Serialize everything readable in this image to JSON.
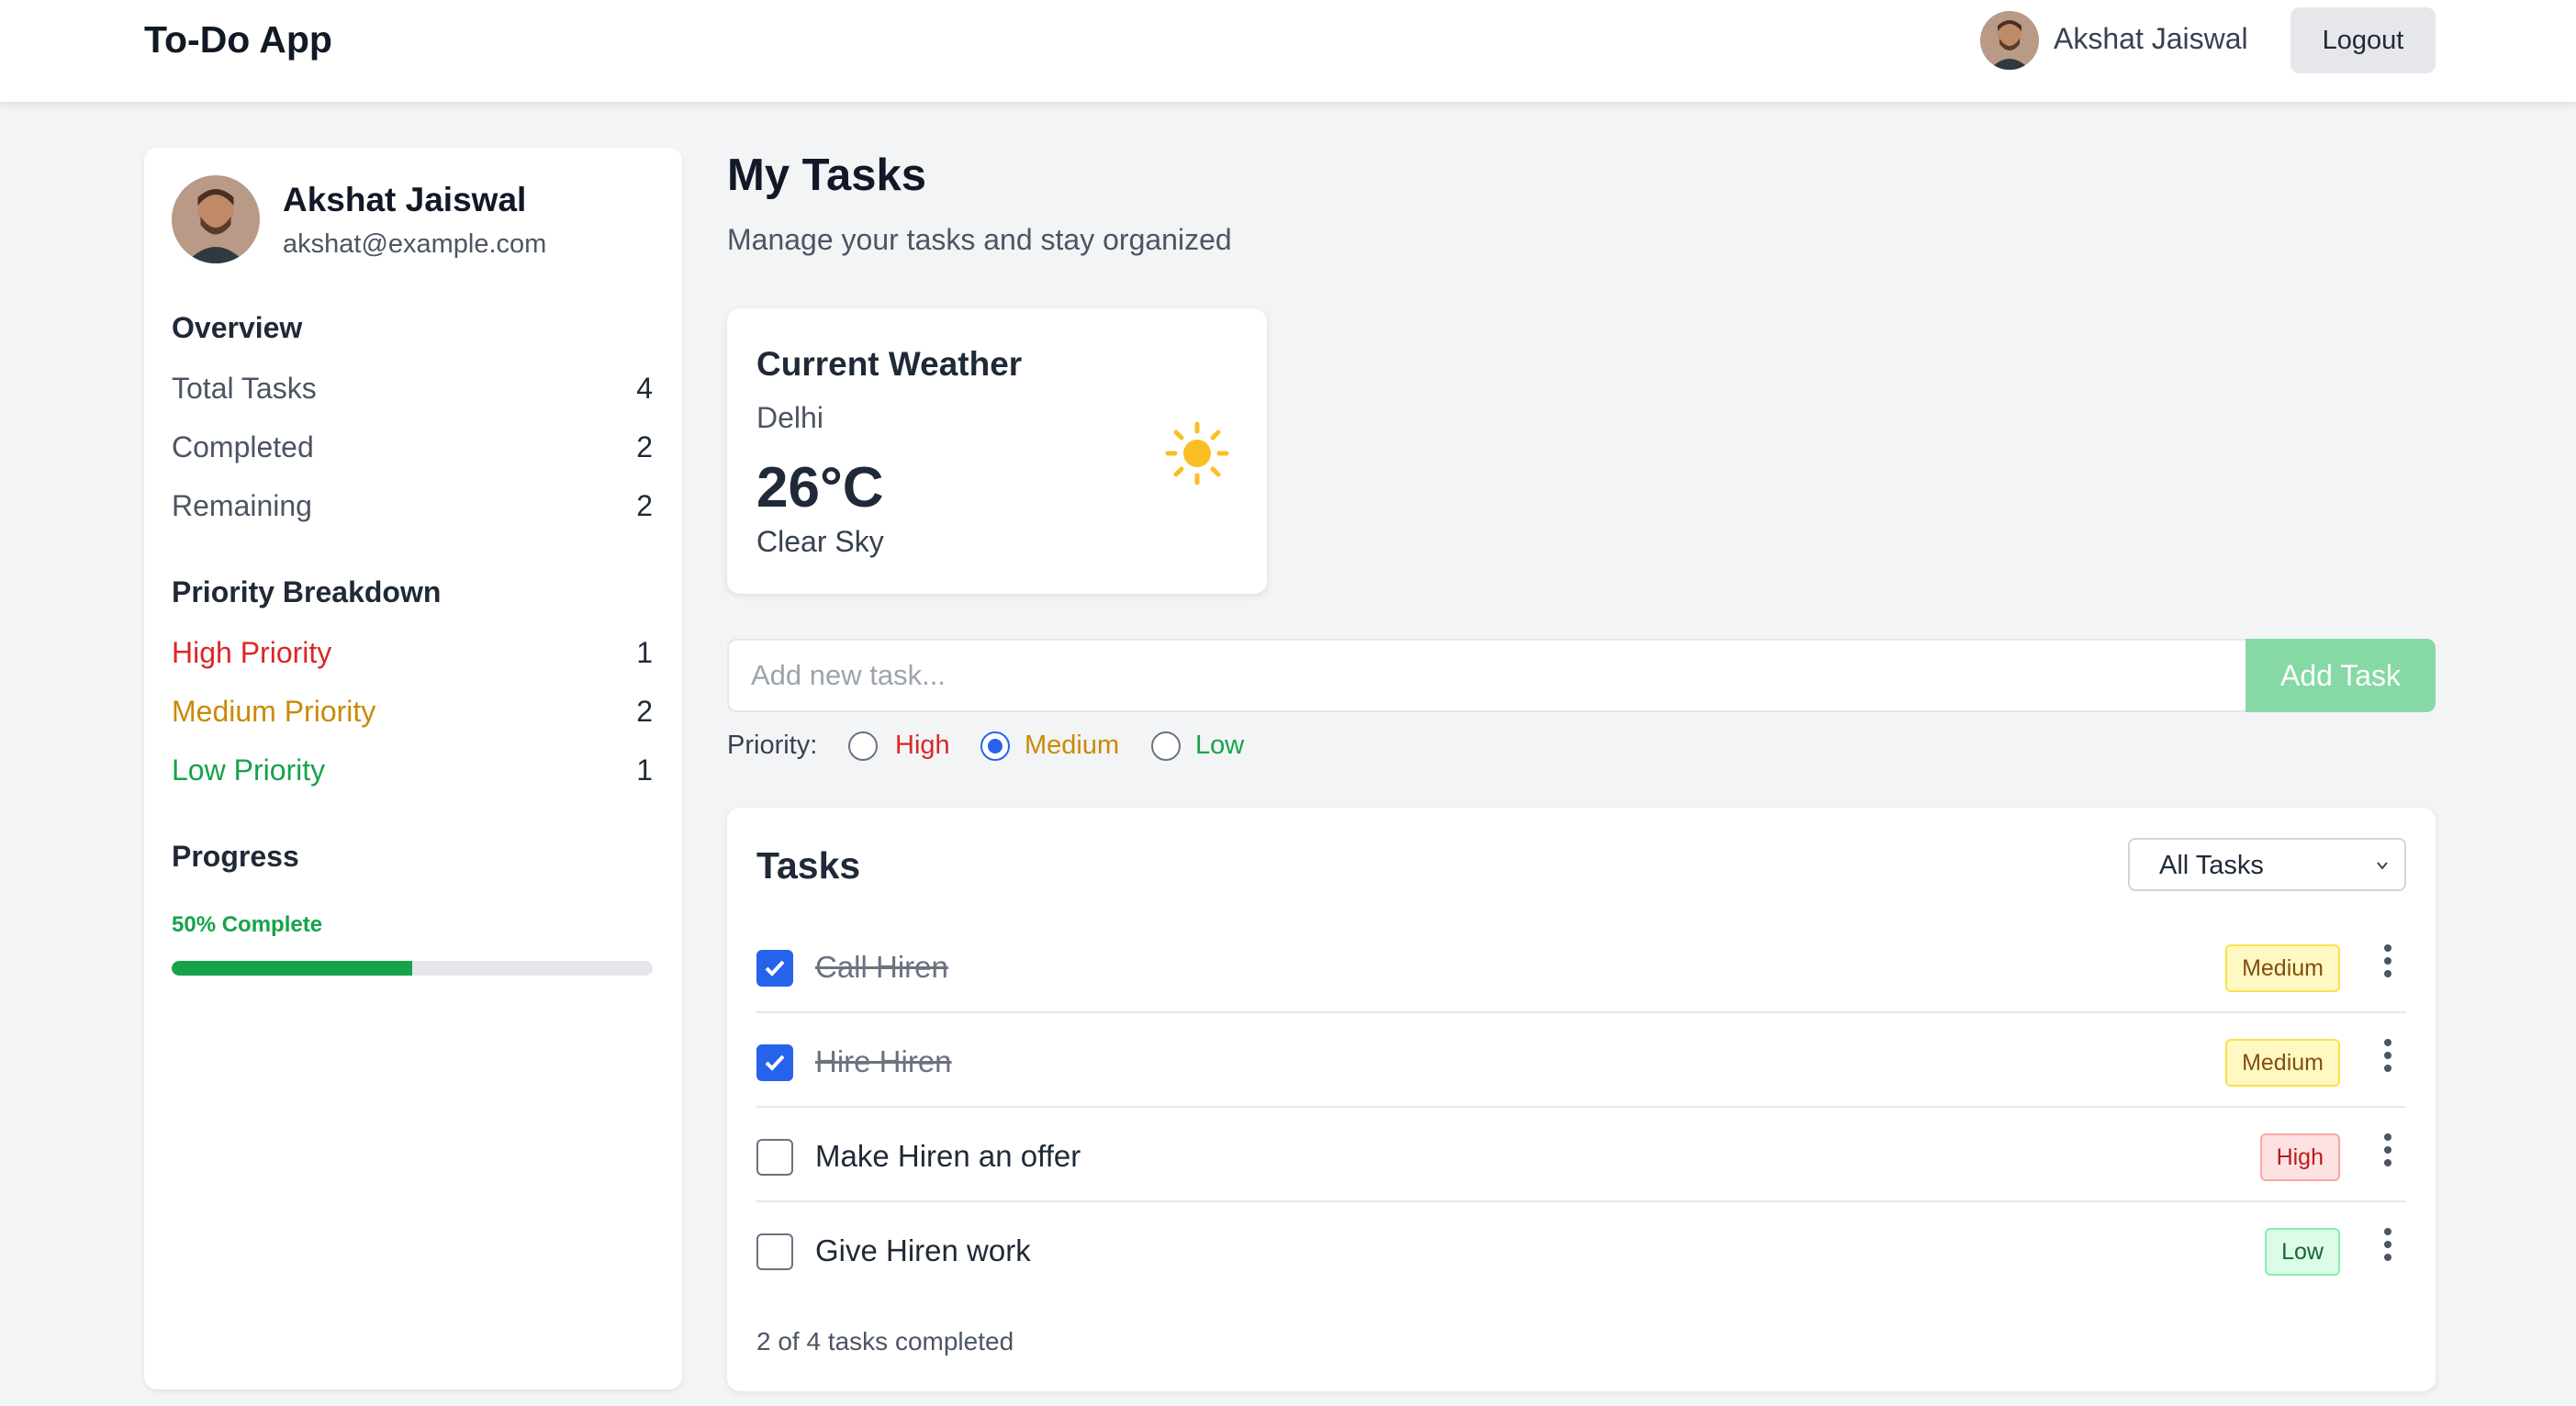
{
  "app": {
    "title": "To-Do App"
  },
  "nav": {
    "user_name": "Akshat Jaiswal",
    "logout_label": "Logout"
  },
  "profile": {
    "name": "Akshat Jaiswal",
    "email": "akshat@example.com"
  },
  "overview": {
    "title": "Overview",
    "stats": [
      {
        "label": "Total Tasks",
        "value": "4"
      },
      {
        "label": "Completed",
        "value": "2"
      },
      {
        "label": "Remaining",
        "value": "2"
      }
    ]
  },
  "priority_breakdown": {
    "title": "Priority Breakdown",
    "items": [
      {
        "label": "High Priority",
        "value": "1",
        "color": "#dc2626"
      },
      {
        "label": "Medium Priority",
        "value": "2",
        "color": "#ca8a04"
      },
      {
        "label": "Low Priority",
        "value": "1",
        "color": "#16a34a"
      }
    ]
  },
  "progress": {
    "title": "Progress",
    "text": "50% Complete",
    "percent": 50
  },
  "main": {
    "title": "My Tasks",
    "subtitle": "Manage your tasks and stay organized"
  },
  "weather": {
    "title": "Current Weather",
    "city": "Delhi",
    "temp": "26°C",
    "condition": "Clear Sky",
    "icon": "sun-icon"
  },
  "add_task": {
    "placeholder": "Add new task...",
    "button_label": "Add Task",
    "priority_label": "Priority:",
    "options": [
      {
        "label": "High",
        "checked": false
      },
      {
        "label": "Medium",
        "checked": true
      },
      {
        "label": "Low",
        "checked": false
      }
    ]
  },
  "tasks": {
    "title": "Tasks",
    "filter_value": "All Tasks",
    "items": [
      {
        "text": "Call Hiren",
        "done": true,
        "priority": "Medium"
      },
      {
        "text": "Hire Hiren",
        "done": true,
        "priority": "Medium"
      },
      {
        "text": "Make Hiren an offer",
        "done": false,
        "priority": "High"
      },
      {
        "text": "Give Hiren work",
        "done": false,
        "priority": "Low"
      }
    ],
    "footer": "2 of 4 tasks completed"
  },
  "colors": {
    "accent": "#2563eb",
    "success": "#16a34a",
    "add_button": "#86d9a4"
  }
}
